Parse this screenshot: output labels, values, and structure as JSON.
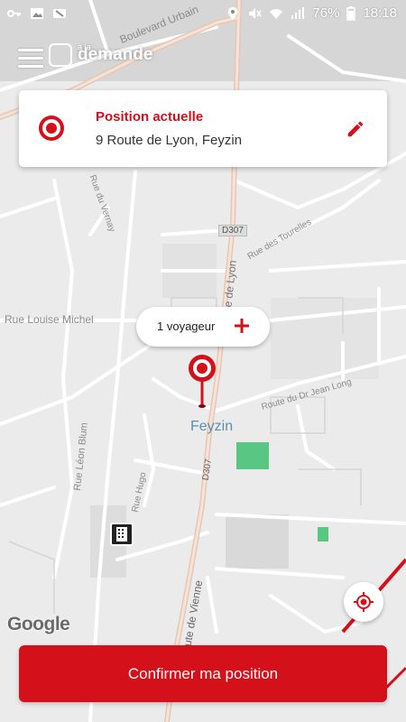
{
  "status_bar": {
    "battery": "76%",
    "time": "18:18"
  },
  "app": {
    "logo_small": "à la",
    "logo_text": "demande"
  },
  "location_card": {
    "title": "Position actuelle",
    "address": "9 Route de Lyon, Feyzin"
  },
  "passengers": {
    "label": "1 voyageur"
  },
  "map": {
    "labels": {
      "boulevard_urbain": "Boulevard Urbain",
      "rue_louise_michel": "Rue Louise Michel",
      "route_de_lyon": "Route de Lyon",
      "d307_top": "D307",
      "d307_mid": "D307",
      "rue_leon_blum": "Rue Léon Blum",
      "route_de_vienne": "Route de Vienne",
      "feyzin": "Feyzin",
      "rue_du_vernay": "Rue du Vernay",
      "route_jean_jaures": "Route du Dr Jean Long",
      "rue_hugo": "Rue Hugo",
      "rue_tourelles": "Rue des Tourelles"
    },
    "attribution": "Google"
  },
  "confirm_button": {
    "label": "Confirmer ma position"
  },
  "colors": {
    "accent": "#d4101b",
    "map_bg": "#ececec",
    "road_main": "#e8c9b9",
    "park": "#59c783"
  }
}
